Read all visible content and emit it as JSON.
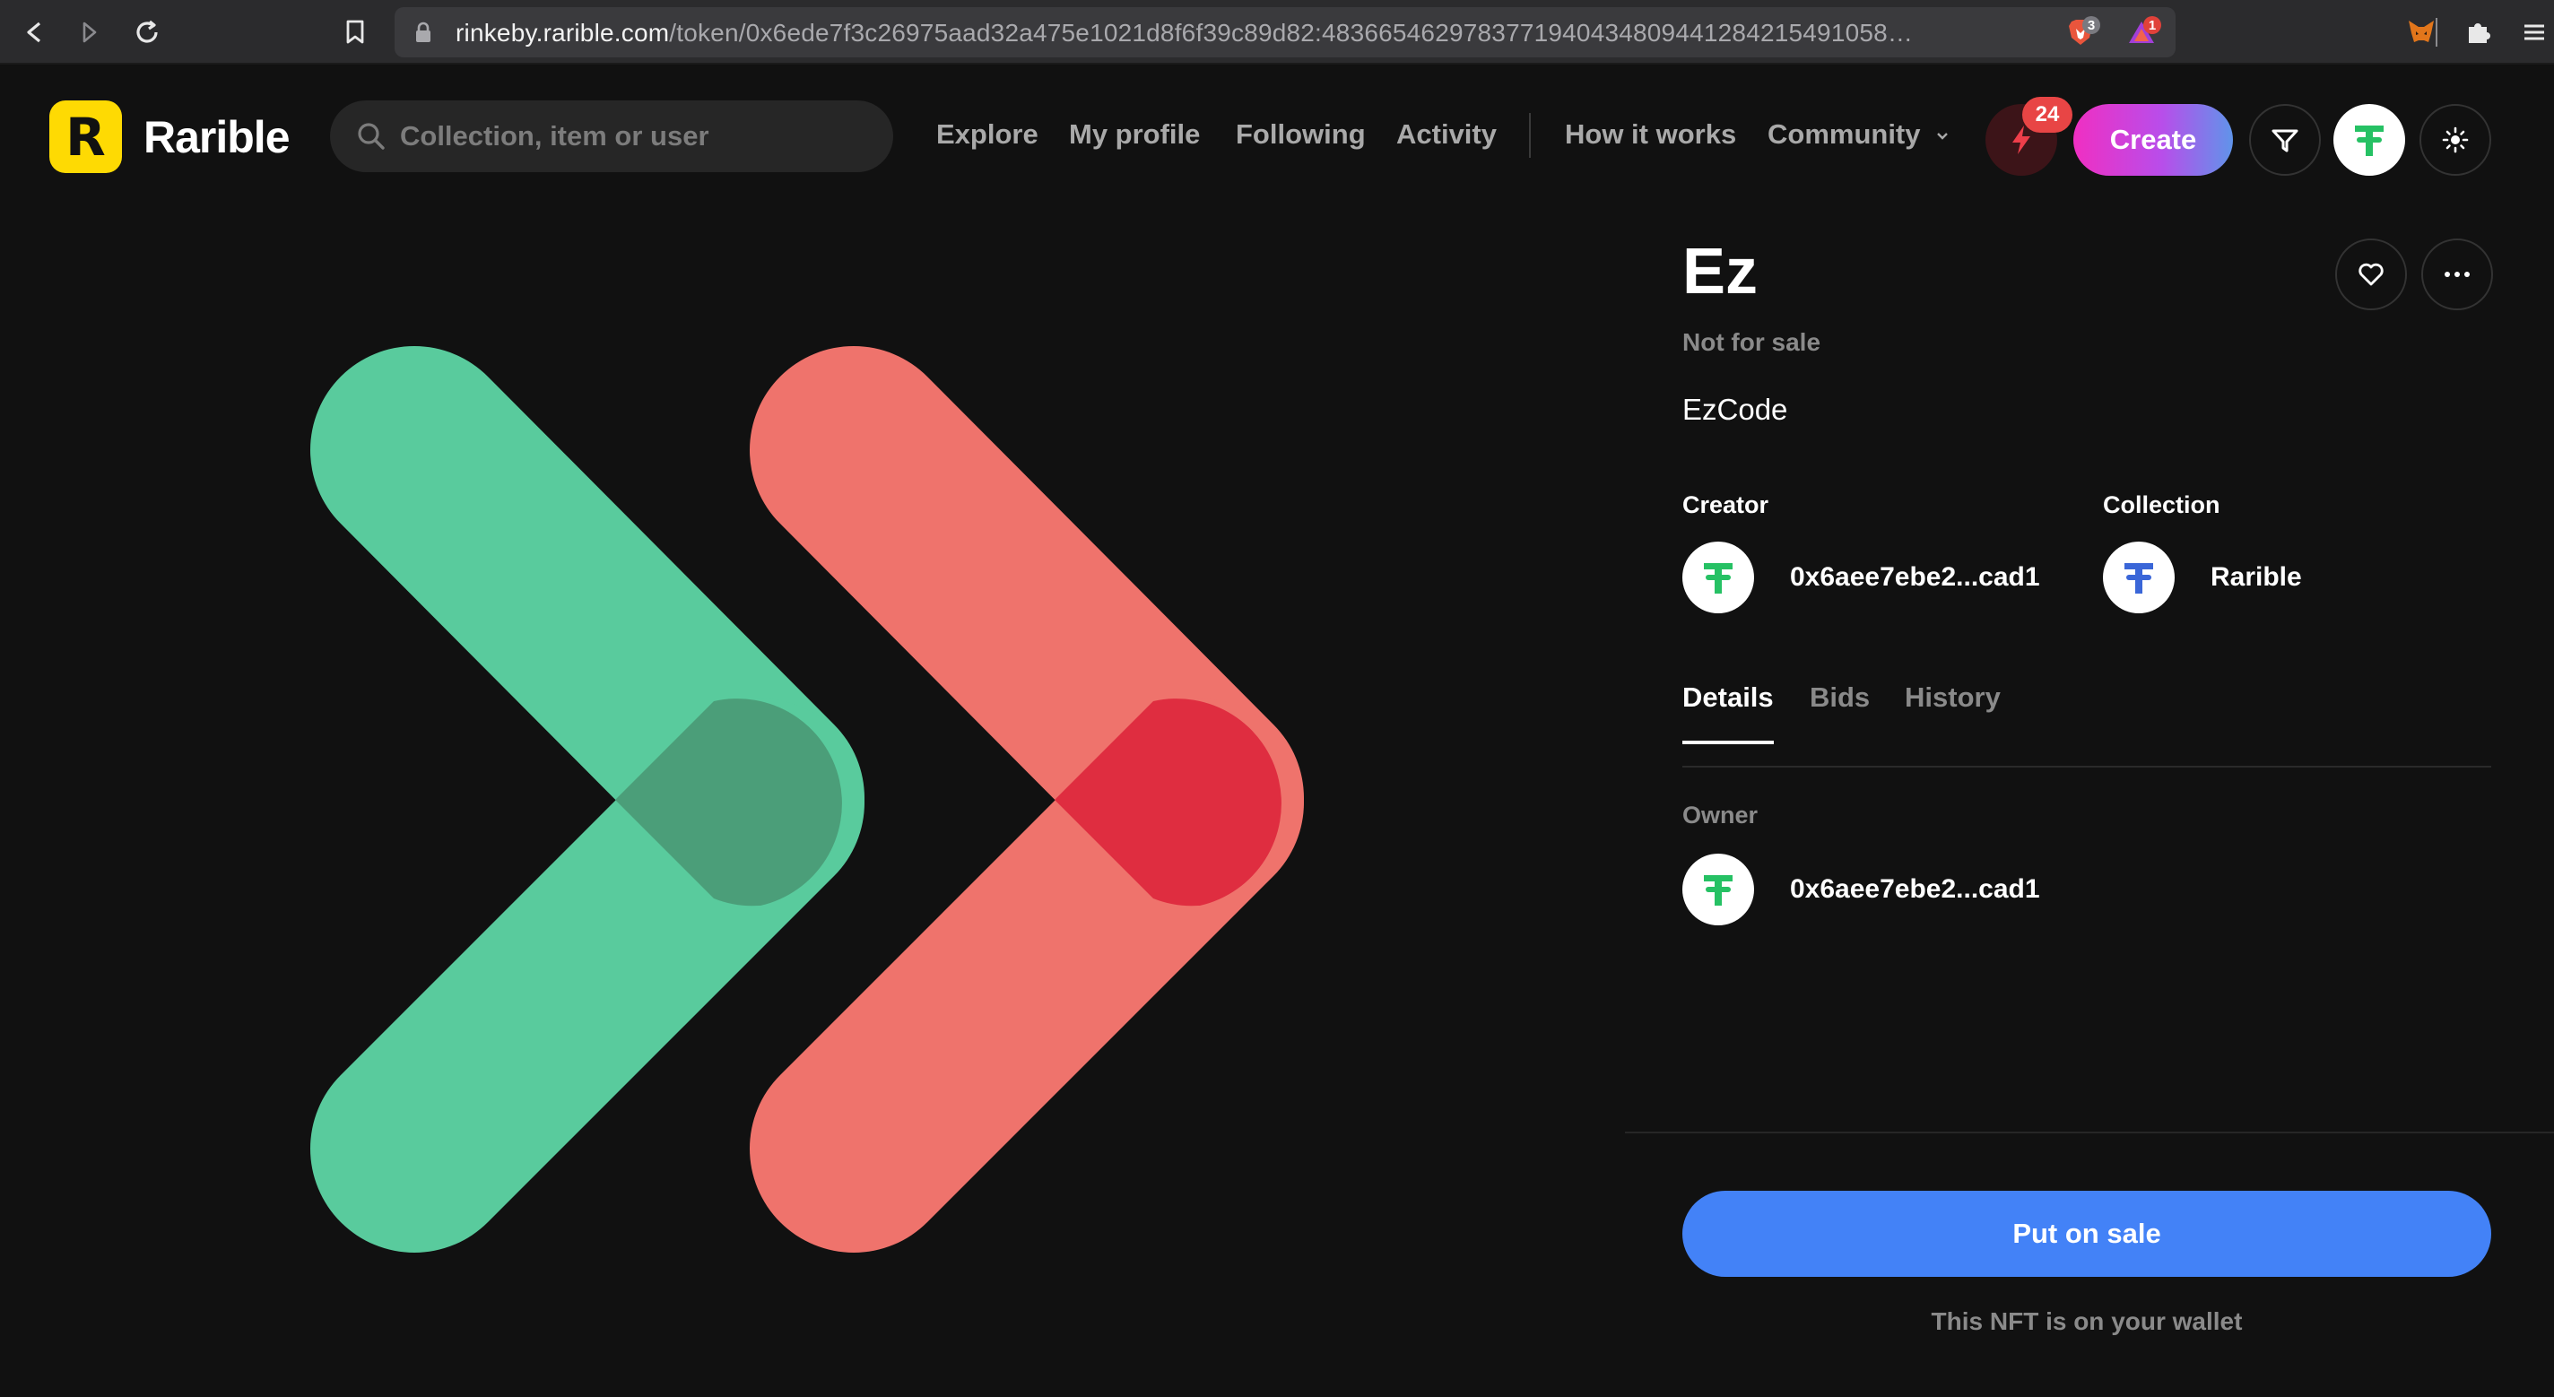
{
  "browser": {
    "url_host": "rinkeby.rarible.com",
    "url_path": "/token/0x6ede7f3c26975aad32a475e1021d8f6f39c89d82:4836654629783771940434809441284215491058…",
    "brave_badge": "3",
    "alert_badge": "1"
  },
  "header": {
    "brand": "Rarible",
    "logo_letter": "R",
    "search_placeholder": "Collection, item or user",
    "nav": [
      "Explore",
      "My profile",
      "Following",
      "Activity",
      "How it works",
      "Community"
    ],
    "activity_count": "24",
    "create_label": "Create"
  },
  "item": {
    "title": "Ez",
    "status": "Not for sale",
    "description": "EzCode",
    "creator_label": "Creator",
    "creator_name": "0x6aee7ebe2...cad1",
    "collection_label": "Collection",
    "collection_name": "Rarible",
    "tabs": [
      "Details",
      "Bids",
      "History"
    ],
    "owner_label": "Owner",
    "owner_name": "0x6aee7ebe2...cad1",
    "sale_button": "Put on sale",
    "wallet_note": "This NFT is on your wallet"
  },
  "colors": {
    "accent_blue": "#4382f7",
    "logo_yellow": "#feda03",
    "art_green": "#59cb9d",
    "art_red": "#ef736c"
  },
  "icons": {
    "nav_back": "arrow-left-icon",
    "nav_forward": "arrow-right-icon",
    "reload": "reload-icon",
    "bookmark": "bookmark-icon",
    "lock": "lock-icon",
    "search": "search-icon",
    "bolt": "bolt-icon",
    "filter": "filter-icon",
    "theme": "sun-icon",
    "like": "heart-icon",
    "more": "more-icon"
  }
}
